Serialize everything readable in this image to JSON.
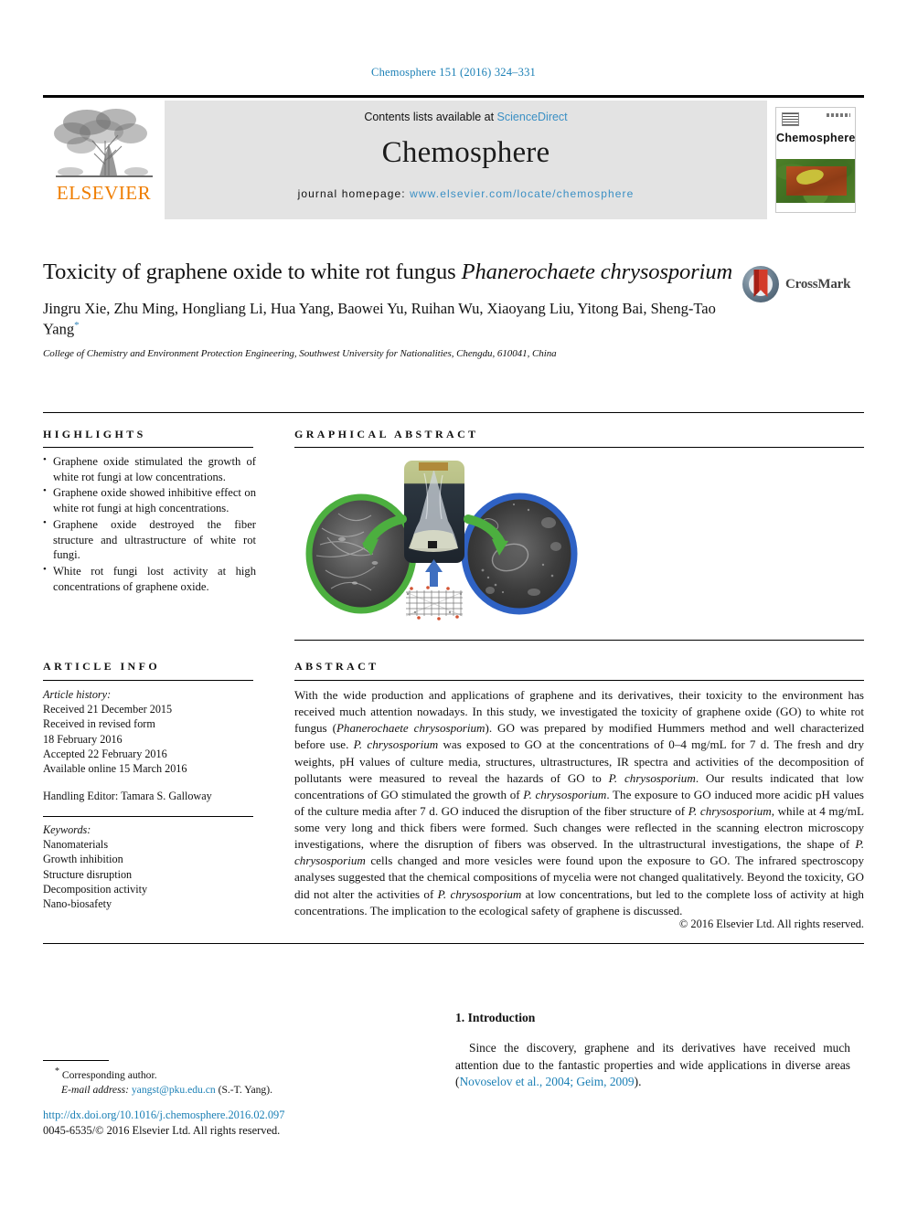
{
  "running_head": "Chemosphere 151 (2016) 324–331",
  "masthead": {
    "elsevier_wordmark": "ELSEVIER",
    "contents_prefix": "Contents lists available at ",
    "sciencedirect_link": "ScienceDirect",
    "journal_name": "Chemosphere",
    "homepage_prefix": "journal homepage: ",
    "homepage_url": "www.elsevier.com/locate/chemosphere",
    "cover_title": "Chemosphere",
    "link_color": "#3a8fc4",
    "panel_color": "#e3e3e3",
    "elsevier_orange": "#ef7d00"
  },
  "crossmark": {
    "label": "CrossMark"
  },
  "article": {
    "title_part1": "Toxicity of graphene oxide to white rot fungus ",
    "title_species": "Phanerochaete chrysosporium",
    "authors": "Jingru Xie, Zhu Ming, Hongliang Li, Hua Yang, Baowei Yu, Ruihan Wu, Xiaoyang Liu, Yitong Bai, Sheng-Tao Yang",
    "corresponding_marker": "*",
    "affiliation": "College of Chemistry and Environment Protection Engineering, Southwest University for Nationalities, Chengdu, 610041, China"
  },
  "highlights": {
    "heading": "HIGHLIGHTS",
    "items": [
      "Graphene oxide stimulated the growth of white rot fungi at low concentrations.",
      "Graphene oxide showed inhibitive effect on white rot fungi at high concentrations.",
      "Graphene oxide destroyed the fiber structure and ultrastructure of white rot fungi.",
      "White rot fungi lost activity at high concentrations of graphene oxide."
    ]
  },
  "graphical_abstract": {
    "heading": "GRAPHICAL ABSTRACT",
    "elements": {
      "left_circle_ring_color": "#4caf3f",
      "right_circle_ring_color": "#2f62c4",
      "arrow_color": "#4caf3f",
      "blue_arrow_color": "#3f6fc0",
      "flask_caption": "",
      "lattice_caption": ""
    }
  },
  "article_info": {
    "heading": "ARTICLE INFO",
    "history_label": "Article history:",
    "history_lines": [
      "Received 21 December 2015",
      "Received in revised form",
      "18 February 2016",
      "Accepted 22 February 2016",
      "Available online 15 March 2016"
    ],
    "handling_editor": "Handling Editor: Tamara S. Galloway",
    "keywords_label": "Keywords:",
    "keywords": [
      "Nanomaterials",
      "Growth inhibition",
      "Structure disruption",
      "Decomposition activity",
      "Nano-biosafety"
    ]
  },
  "abstract": {
    "heading": "ABSTRACT",
    "p1": "With the wide production and applications of graphene and its derivatives, their toxicity to the environment has received much attention nowadays. In this study, we investigated the toxicity of graphene oxide (GO) to white rot fungus (",
    "species1": "Phanerochaete chrysosporium",
    "p2": "). GO was prepared by modified Hummers method and well characterized before use. ",
    "species2": "P. chrysosporium",
    "p3": " was exposed to GO at the concentrations of 0–4 mg/mL for 7 d. The fresh and dry weights, pH values of culture media, structures, ultrastructures, IR spectra and activities of the decomposition of pollutants were measured to reveal the hazards of GO to ",
    "species3": "P. chrysosporium",
    "p4": ". Our results indicated that low concentrations of GO stimulated the growth of ",
    "species4": "P. chrysosporium",
    "p5": ". The exposure to GO induced more acidic pH values of the culture media after 7 d. GO induced the disruption of the fiber structure of ",
    "species5": "P. chrysosporium",
    "p6": ", while at 4 mg/mL some very long and thick fibers were formed. Such changes were reflected in the scanning electron microscopy investigations, where the disruption of fibers was observed. In the ultrastructural investigations, the shape of ",
    "species6": "P. chrysosporium",
    "p7": " cells changed and more vesicles were found upon the exposure to GO. The infrared spectroscopy analyses suggested that the chemical compositions of mycelia were not changed qualitatively. Beyond the toxicity, GO did not alter the activities of ",
    "species7": "P. chrysosporium",
    "p8": " at low concentrations, but led to the complete loss of activity at high concentrations. The implication to the ecological safety of graphene is discussed.",
    "copyright": "© 2016 Elsevier Ltd. All rights reserved."
  },
  "body": {
    "section_number_title": "1. Introduction",
    "paragraph_text": "Since the discovery, graphene and its derivatives have received much attention due to the fantastic properties and wide applications in diverse areas (",
    "citation": "Novoselov et al., 2004; Geim, 2009",
    "paragraph_tail": ")."
  },
  "footer": {
    "corresponding_star": "*",
    "corresponding_text": "Corresponding author.",
    "email_label": "E-mail address:",
    "email": "yangst@pku.edu.cn",
    "email_suffix": " (S.-T. Yang).",
    "doi": "http://dx.doi.org/10.1016/j.chemosphere.2016.02.097",
    "issn_copyright": "0045-6535/© 2016 Elsevier Ltd. All rights reserved."
  }
}
